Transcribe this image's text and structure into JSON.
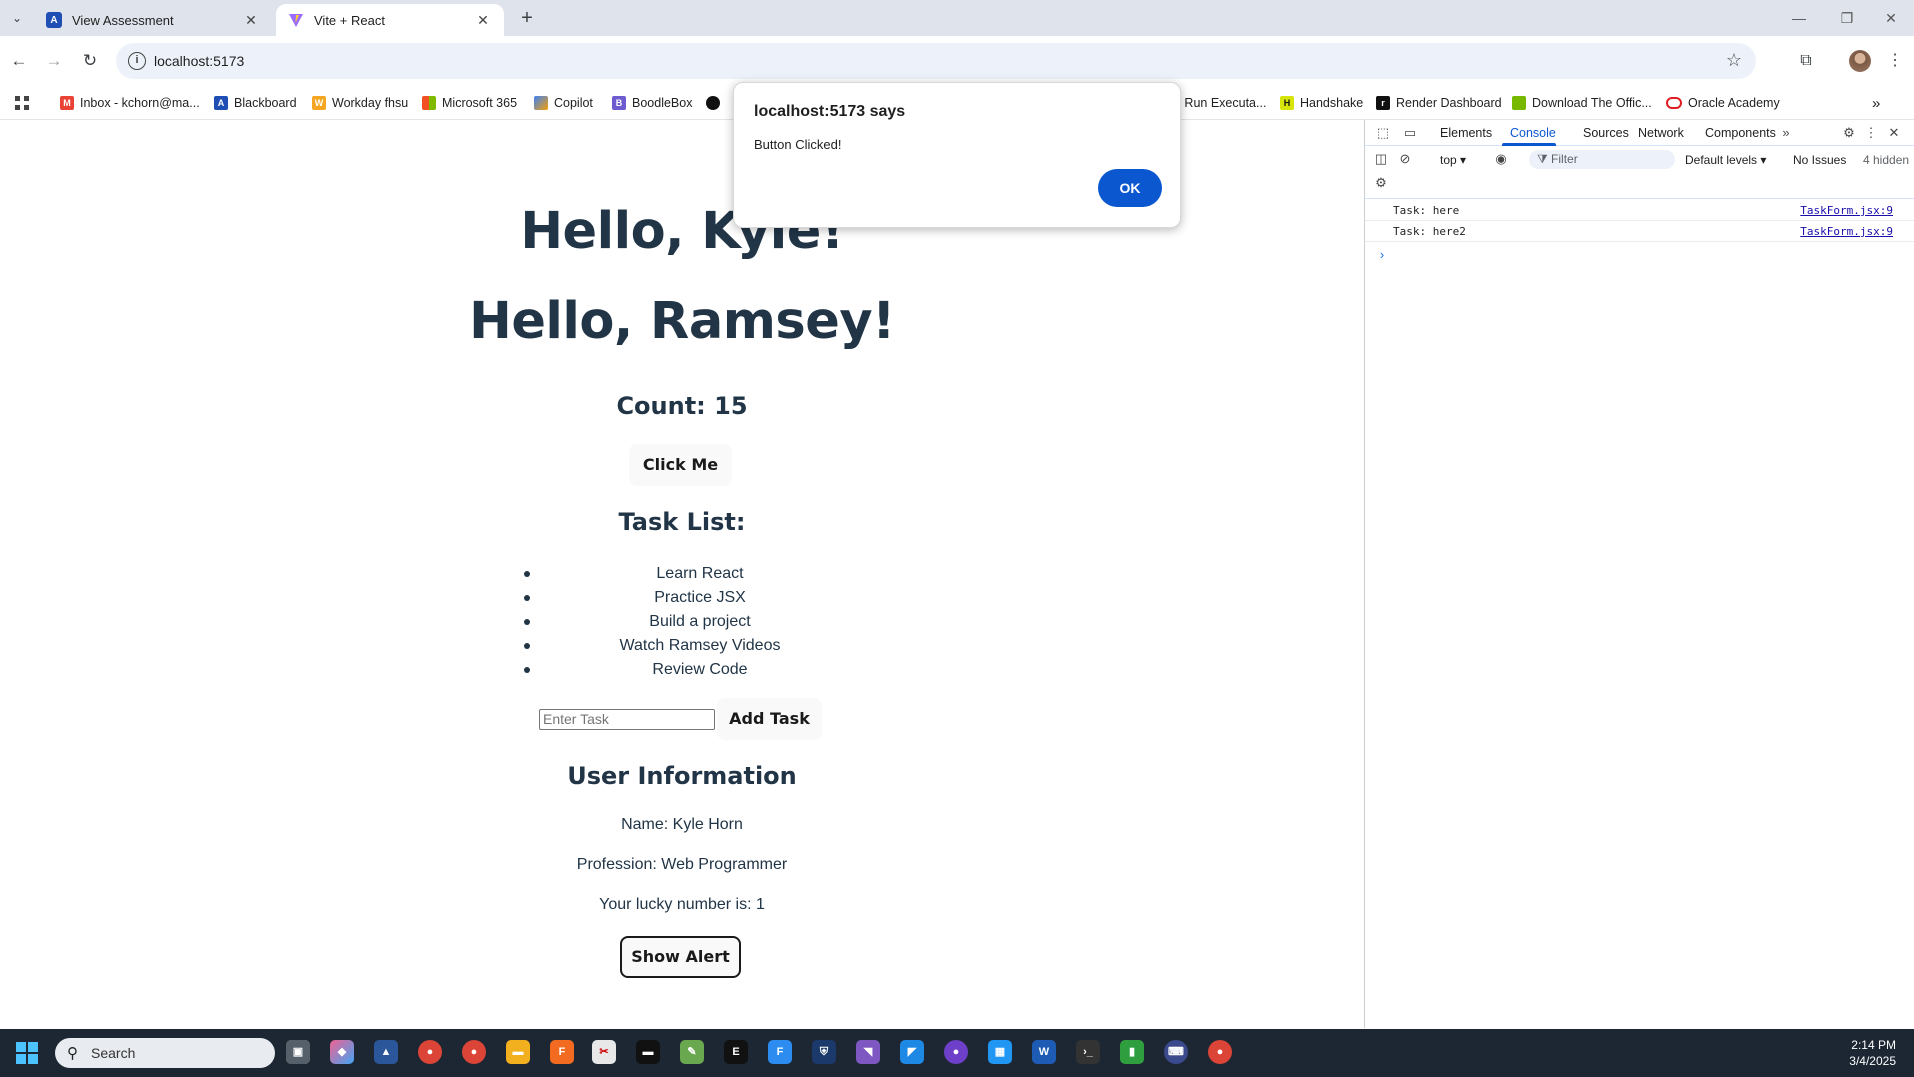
{
  "tabs": [
    {
      "title": "View Assessment",
      "active": false
    },
    {
      "title": "Vite + React",
      "active": true
    }
  ],
  "address": {
    "url": "localhost:5173"
  },
  "bookmarks": [
    {
      "label": "Inbox - kchorn@ma...",
      "icon": "gmail-icon",
      "color": "#ea4335"
    },
    {
      "label": "Blackboard",
      "icon": "blackboard-icon",
      "color": "#1f4fb5"
    },
    {
      "label": "Workday fhsu",
      "icon": "workday-icon",
      "color": "#f5a623"
    },
    {
      "label": "Microsoft 365",
      "icon": "microsoft-icon",
      "color": "#f25022"
    },
    {
      "label": "Copilot",
      "icon": "copilot-icon",
      "color": "#3b82f6"
    },
    {
      "label": "BoodleBox",
      "icon": "boodlebox-icon",
      "color": "#6d5bd0"
    },
    {
      "label": "o Run Executa...",
      "icon": "page-icon",
      "color": "#9aa0a6"
    },
    {
      "label": "Handshake",
      "icon": "handshake-icon",
      "color": "#d7e40a"
    },
    {
      "label": "Render Dashboard",
      "icon": "render-icon",
      "color": "#111111"
    },
    {
      "label": "Download The Offic...",
      "icon": "nvidia-icon",
      "color": "#76b900"
    },
    {
      "label": "Oracle Academy",
      "icon": "oracle-icon",
      "color": "#e11b22"
    }
  ],
  "app": {
    "greetings": [
      "Hello, Kyle!",
      "Hello, Ramsey!"
    ],
    "count_text": "Count: 15",
    "click_button": "Click Me",
    "task_heading": "Task List:",
    "tasks": [
      "Learn React",
      "Practice JSX",
      "Build a project",
      "Watch Ramsey Videos",
      "Review Code"
    ],
    "task_placeholder": "Enter Task",
    "add_task_button": "Add Task",
    "user_heading": "User Information",
    "name_line": "Name: Kyle Horn",
    "profession_line": "Profession: Web Programmer",
    "lucky_line": "Your lucky number is: 1",
    "alert_button": "Show Alert"
  },
  "dialog": {
    "title": "localhost:5173 says",
    "message": "Button Clicked!",
    "ok": "OK"
  },
  "devtools": {
    "tabs": [
      "Elements",
      "Console",
      "Sources",
      "Network",
      "Components"
    ],
    "active_tab": "Console",
    "context": "top",
    "filter_placeholder": "Filter",
    "levels": "Default levels",
    "issues": "No Issues",
    "hidden": "4 hidden",
    "logs": [
      {
        "message": "Task: here",
        "source": "TaskForm.jsx:9"
      },
      {
        "message": "Task: here2",
        "source": "TaskForm.jsx:9"
      }
    ]
  },
  "taskbar": {
    "search_label": "Search",
    "time": "2:14 PM",
    "date": "3/4/2025"
  },
  "colors": {
    "accent": "#0b57d0",
    "page_text": "#213547",
    "taskbar": "#1c2733"
  }
}
